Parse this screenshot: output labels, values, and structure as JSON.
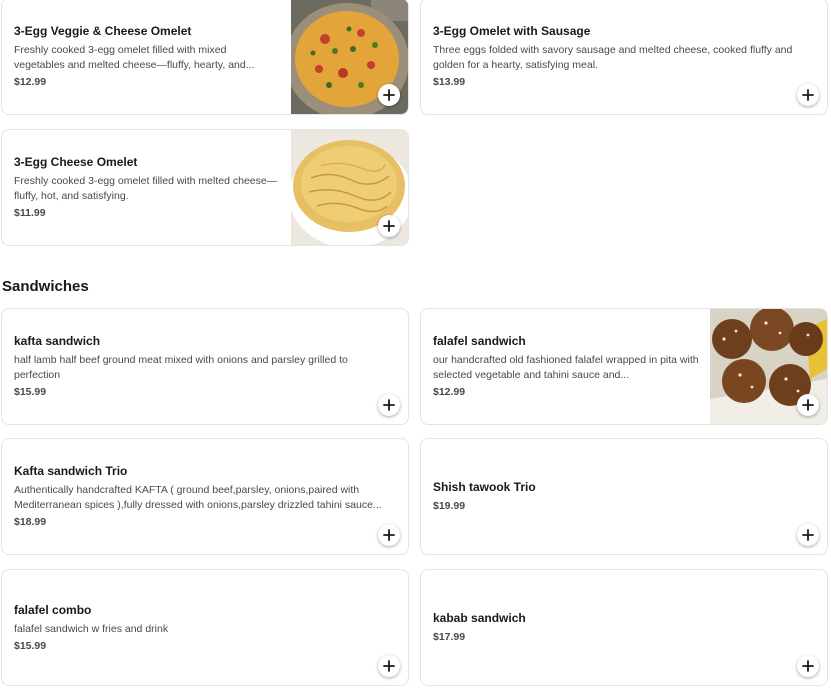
{
  "sections": [
    {
      "items": [
        {
          "title": "3-Egg Veggie & Cheese Omelet",
          "description": "Freshly cooked 3-egg omelet filled with mixed vegetables and melted cheese—fluffy, hearty, and...",
          "price": "$12.99",
          "image": "veggie-omelet-photo"
        },
        {
          "title": "3-Egg Omelet with Sausage",
          "description": "Three eggs folded with savory sausage and melted cheese, cooked fluffy and golden for a hearty, satisfying meal.",
          "price": "$13.99"
        },
        {
          "title": "3-Egg Cheese Omelet",
          "description": "Freshly cooked 3-egg omelet filled with melted cheese—fluffy, hot, and satisfying.",
          "price": "$11.99",
          "image": "cheese-omelet-photo"
        }
      ]
    },
    {
      "heading": "Sandwiches",
      "items": [
        {
          "title": "kafta sandwich",
          "description": "half lamb half beef ground meat mixed with onions and parsley grilled to perfection",
          "price": "$15.99"
        },
        {
          "title": "falafel sandwich",
          "description": "our handcrafted old fashioned falafel wrapped in pita with selected vegetable and tahini sauce and...",
          "price": "$12.99",
          "image": "falafel-photo"
        },
        {
          "title": "Kafta sandwich Trio",
          "description": "Authentically handcrafted KAFTA ( ground beef,parsley, onions,paired with Mediterranean spices ),fully dressed with onions,parsley drizzled tahini sauce...",
          "price": "$18.99"
        },
        {
          "title": "Shish tawook Trio",
          "price": "$19.99"
        },
        {
          "title": "falafel combo",
          "description": "falafel sandwich w fries and drink",
          "price": "$15.99"
        },
        {
          "title": "kabab sandwich",
          "price": "$17.99"
        }
      ]
    }
  ],
  "add_button_icon": "plus-icon"
}
